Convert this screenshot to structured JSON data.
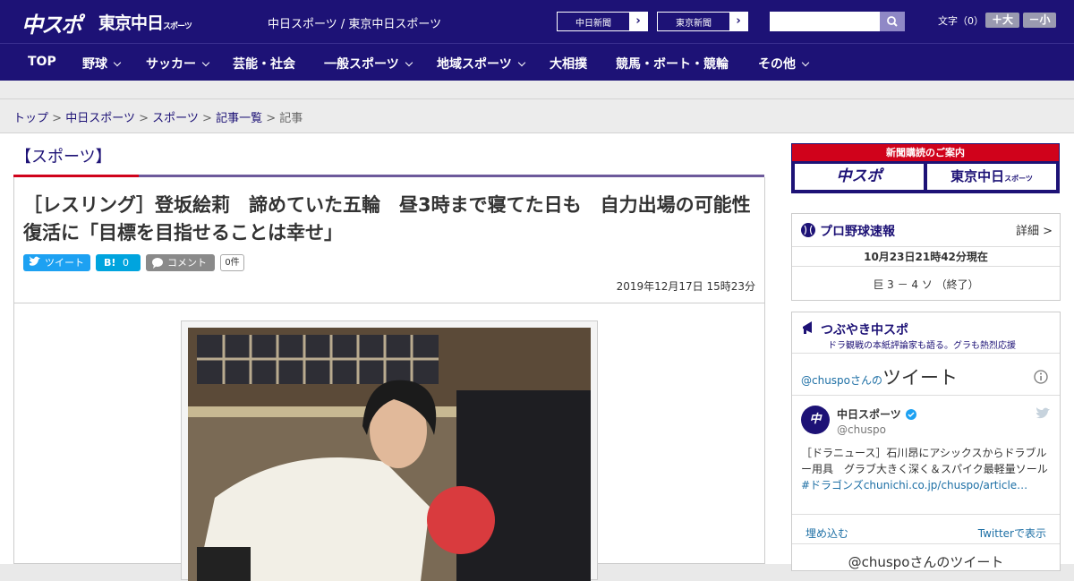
{
  "header": {
    "logo_chuspo": "中スポ",
    "logo_tokyo": "東京中日",
    "logo_tokyo_small": "スポーツ",
    "site_names": "中日スポーツ / 東京中日スポーツ",
    "btn_chunichi": "中日新聞",
    "btn_tokyo": "東京新聞",
    "search_placeholder": "",
    "font_size_label": "文字（0）",
    "font_plus": "＋大",
    "font_minus": "－小"
  },
  "nav": [
    "TOP",
    "野球",
    "サッカー",
    "芸能・社会",
    "一般スポーツ",
    "地域スポーツ",
    "大相撲",
    "競馬・ボート・競輪",
    "その他"
  ],
  "breadcrumb": {
    "items": [
      "トップ",
      "中日スポーツ",
      "スポーツ",
      "記事一覧"
    ],
    "current": "記事",
    "sep": ">"
  },
  "article": {
    "category": "【スポーツ】",
    "title": "［レスリング］登坂絵莉　諦めていた五輪　昼3時まで寝てた日も　自力出場の可能性復活に「目標を目指せることは幸せ」",
    "tweet": "ツイート",
    "hatena_label": "B!",
    "hatena_count": "0",
    "comment": "コメント",
    "comment_count": "0件",
    "date": "2019年12月17日 15時23分"
  },
  "sidebar": {
    "ad_title": "新聞購読のご案内",
    "ad_left": "中スポ",
    "ad_right": "東京中日",
    "ad_right_small": "スポーツ",
    "baseball_title": "プロ野球速報",
    "baseball_more": "詳細 >",
    "baseball_time": "10月23日21時42分現在",
    "baseball_score": "巨 3 － 4 ソ （終了）",
    "tsubuyaki_title": "つぶやき中スポ",
    "tsubuyaki_sub": "ドラ観戦の本紙評論家も語る。グラも熱烈応援",
    "tweet_handle": "@chuspoさんの",
    "tweet_word": "ツイート",
    "tw_name": "中日スポーツ",
    "tw_id": "@chuspo",
    "tw_text": "［ドラニュース］石川昂にアシックスからドラブルー用具　グラブ大きく深く＆スパイク最軽量ソール",
    "tw_link": "#ドラゴンズchunichi.co.jp/chuspo/article…",
    "embed": "埋め込む",
    "view_twitter": "Twitterで表示",
    "bottom_heading": "@chuspoさんのツイート"
  },
  "colors": {
    "brand": "#1d1276",
    "accent": "#d0021b",
    "twitter": "#1da1f2",
    "hatena": "#00a4de"
  }
}
